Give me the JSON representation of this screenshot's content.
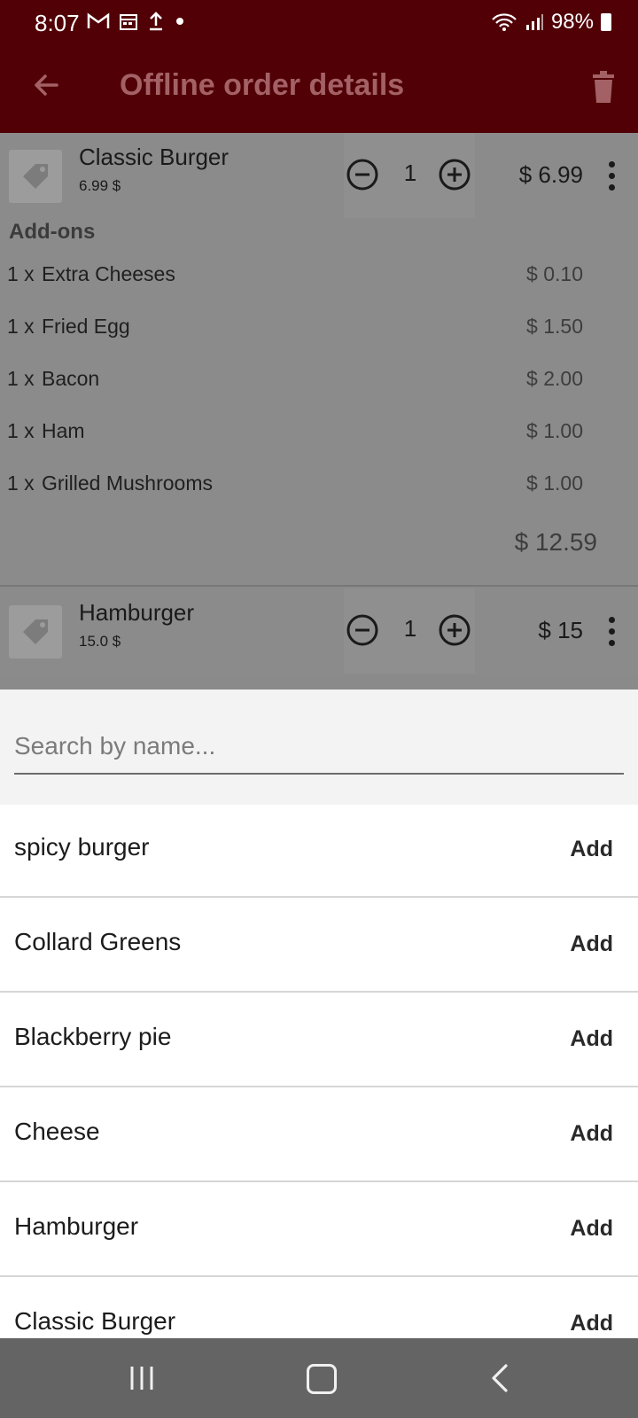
{
  "status_bar": {
    "time": "8:07",
    "battery": "98%"
  },
  "app_bar": {
    "title": "Offline order details"
  },
  "order_items": [
    {
      "name": "Classic Burger",
      "unit_price": "6.99 $",
      "quantity": "1",
      "price": "$ 6.99",
      "addons_title": "Add-ons",
      "addons": [
        {
          "qty": "1 x",
          "name": "Extra Cheeses",
          "price": "$ 0.10"
        },
        {
          "qty": "1 x",
          "name": "Fried Egg",
          "price": "$ 1.50"
        },
        {
          "qty": "1 x",
          "name": "Bacon",
          "price": "$ 2.00"
        },
        {
          "qty": "1 x",
          "name": "Ham",
          "price": "$ 1.00"
        },
        {
          "qty": "1 x",
          "name": "Grilled Mushrooms",
          "price": "$ 1.00"
        }
      ],
      "total": "$ 12.59"
    },
    {
      "name": "Hamburger",
      "unit_price": "15.0 $",
      "quantity": "1",
      "price": "$ 15"
    }
  ],
  "search": {
    "placeholder": "Search by name..."
  },
  "products": [
    {
      "name": "spicy burger",
      "action": "Add"
    },
    {
      "name": "Collard Greens",
      "action": "Add"
    },
    {
      "name": "Blackberry pie",
      "action": "Add"
    },
    {
      "name": "Cheese",
      "action": "Add"
    },
    {
      "name": "Hamburger",
      "action": "Add"
    },
    {
      "name": "Classic Burger",
      "action": "Add"
    }
  ],
  "colors": {
    "app_bar": "#510006",
    "title_text": "#a36166",
    "nav_bar": "#646464"
  },
  "icons": [
    "gmail-icon",
    "calendar-icon",
    "upload-icon",
    "wifi-icon",
    "signal-icon",
    "battery-icon",
    "back-arrow-icon",
    "trash-icon",
    "tag-icon",
    "minus-circle-icon",
    "plus-circle-icon",
    "more-vert-icon",
    "recents-icon",
    "home-icon",
    "nav-back-icon"
  ]
}
